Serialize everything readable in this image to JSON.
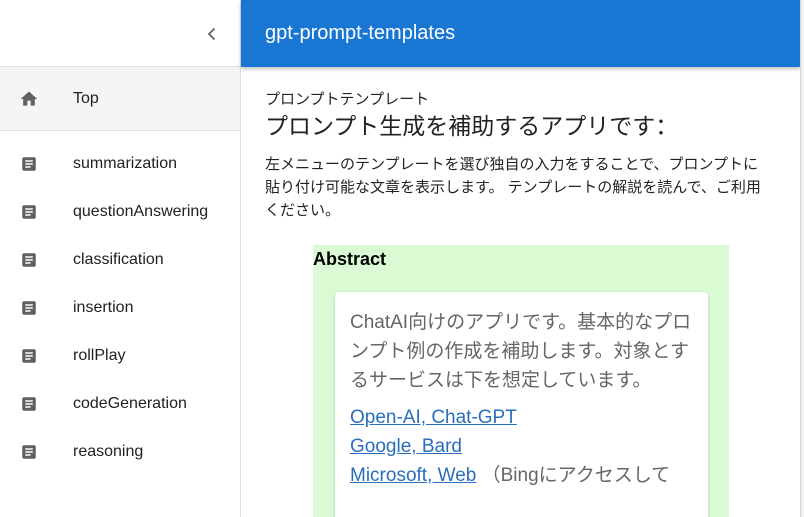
{
  "sidebar": {
    "top_item": {
      "label": "Top",
      "icon": "home-icon"
    },
    "items": [
      {
        "label": "summarization",
        "icon": "document-icon"
      },
      {
        "label": "questionAnswering",
        "icon": "document-icon"
      },
      {
        "label": "classification",
        "icon": "document-icon"
      },
      {
        "label": "insertion",
        "icon": "document-icon"
      },
      {
        "label": "rollPlay",
        "icon": "document-icon"
      },
      {
        "label": "codeGeneration",
        "icon": "document-icon"
      },
      {
        "label": "reasoning",
        "icon": "document-icon"
      }
    ]
  },
  "header": {
    "title": "gpt-prompt-templates",
    "color": "#1976d2"
  },
  "main": {
    "subtitle": "プロンプトテンプレート",
    "heading": "プロンプト生成を補助するアプリです：",
    "description": "左メニューのテンプレートを選び独自の入力をすることで、プロンプトに貼り付け可能な文章を表示します。 テンプレートの解説を読んで、ご利用ください。",
    "abstract": {
      "title": "Abstract",
      "background": "#d9fad2",
      "text": "ChatAI向けのアプリです。基本的なプロンプト例の作成を補助します。対象とするサービスは下を想定しています。",
      "links": [
        {
          "label": "Open-AI, Chat-GPT",
          "suffix": ""
        },
        {
          "label": "Google, Bard",
          "suffix": ""
        },
        {
          "label": "Microsoft, Web",
          "suffix": " （Bingにアクセスして"
        }
      ]
    }
  }
}
